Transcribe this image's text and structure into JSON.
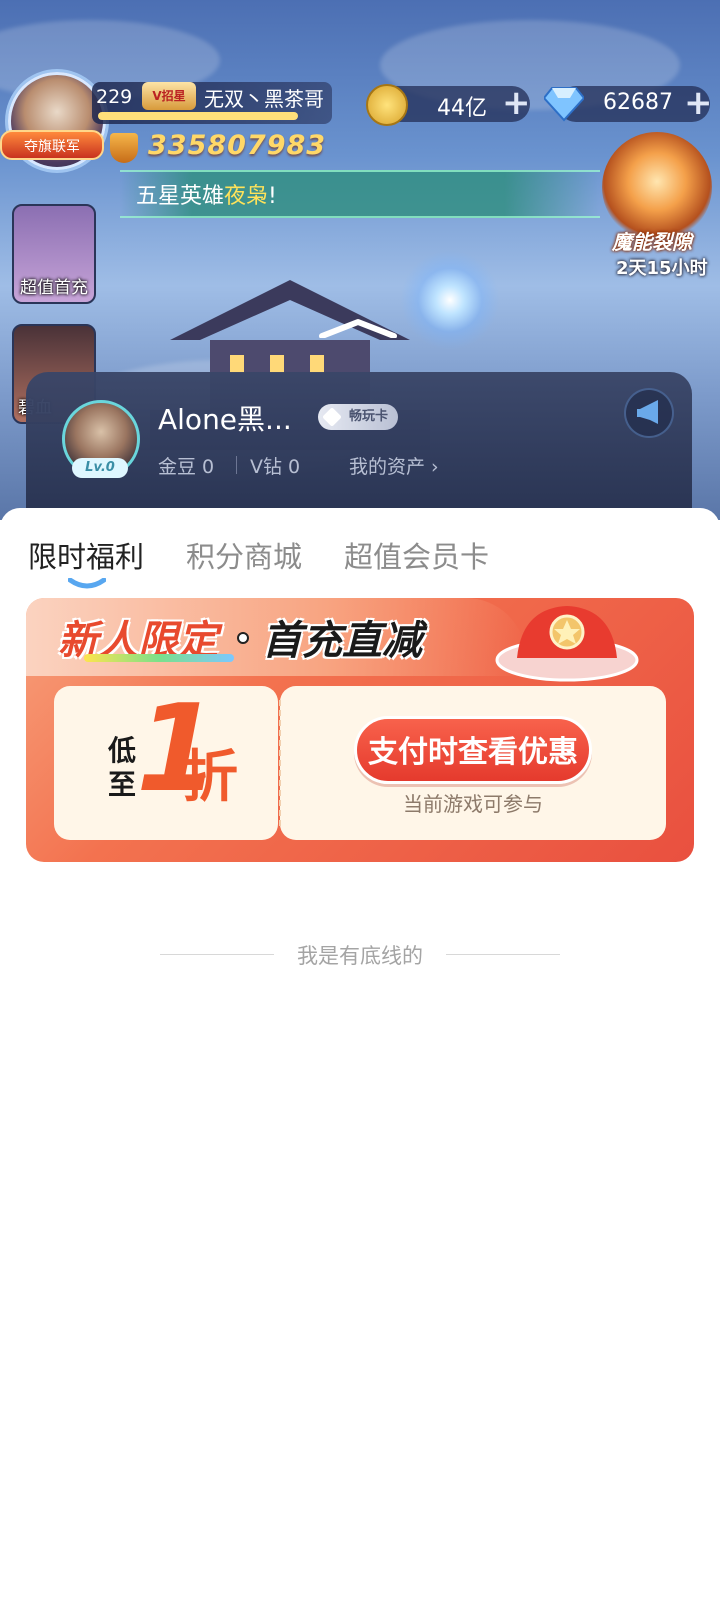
{
  "game": {
    "player_level": "229",
    "vip_badge": "V招星",
    "player_name": "无双丶黑茶哥",
    "avatar_badge": "夺旗联军",
    "power": "335807983",
    "coins": "44亿",
    "gems": "62687",
    "announcement_prefix": "五星英雄",
    "announcement_highlight": "夜枭",
    "announcement_suffix": "!",
    "rift_title": "魔能裂隙",
    "rift_timer": "2天15小时",
    "side_card_1": "超值首充",
    "side_card_2": "碧血",
    "icons": [
      "coin-icon",
      "gem-icon",
      "plus-icon",
      "power-shield-icon",
      "announce-icon"
    ]
  },
  "profile": {
    "name": "Alone黑...",
    "level": "Lv.0",
    "card_badge": "畅玩卡",
    "beans": "金豆 0",
    "v_diamond": "V钻 0",
    "assets": "我的资产 ›"
  },
  "tabs": [
    {
      "label": "限时福利"
    },
    {
      "label": "积分商城"
    },
    {
      "label": "超值会员卡"
    }
  ],
  "promo": {
    "title_part1": "新人限定",
    "title_part2": "首充直减",
    "low_prefix": "低至",
    "big_number": "1",
    "unit": "折",
    "button_label": "支付时查看优惠",
    "sub_label": "当前游戏可参与"
  },
  "footer": {
    "bottom_text": "我是有底线的"
  },
  "colors": {
    "accent": "#f05a2c",
    "promo_bg": "#e9503f",
    "tab_active": "#222222",
    "tab_inactive": "#8c8c8c"
  }
}
